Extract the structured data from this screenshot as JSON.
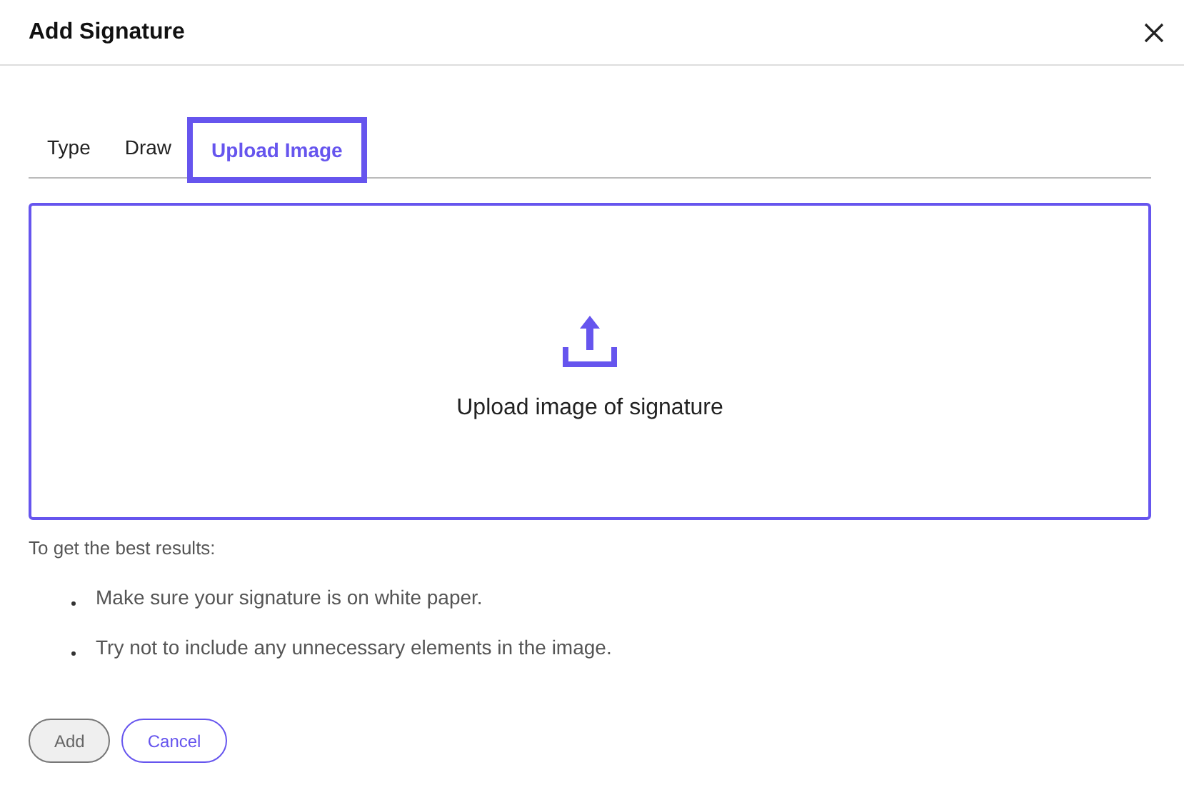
{
  "dialog": {
    "title": "Add Signature"
  },
  "tabs": [
    {
      "label": "Type",
      "selected": false
    },
    {
      "label": "Draw",
      "selected": false
    },
    {
      "label": "Upload Image",
      "selected": true
    }
  ],
  "upload": {
    "label": "Upload image of signature"
  },
  "tips": {
    "heading": "To get the best results:",
    "items": [
      "Make sure your signature is on white paper.",
      "Try not to include any unnecessary elements in the image."
    ]
  },
  "buttons": [
    {
      "label": "Add",
      "disabled": true
    },
    {
      "label": "Cancel",
      "disabled": false
    }
  ]
}
